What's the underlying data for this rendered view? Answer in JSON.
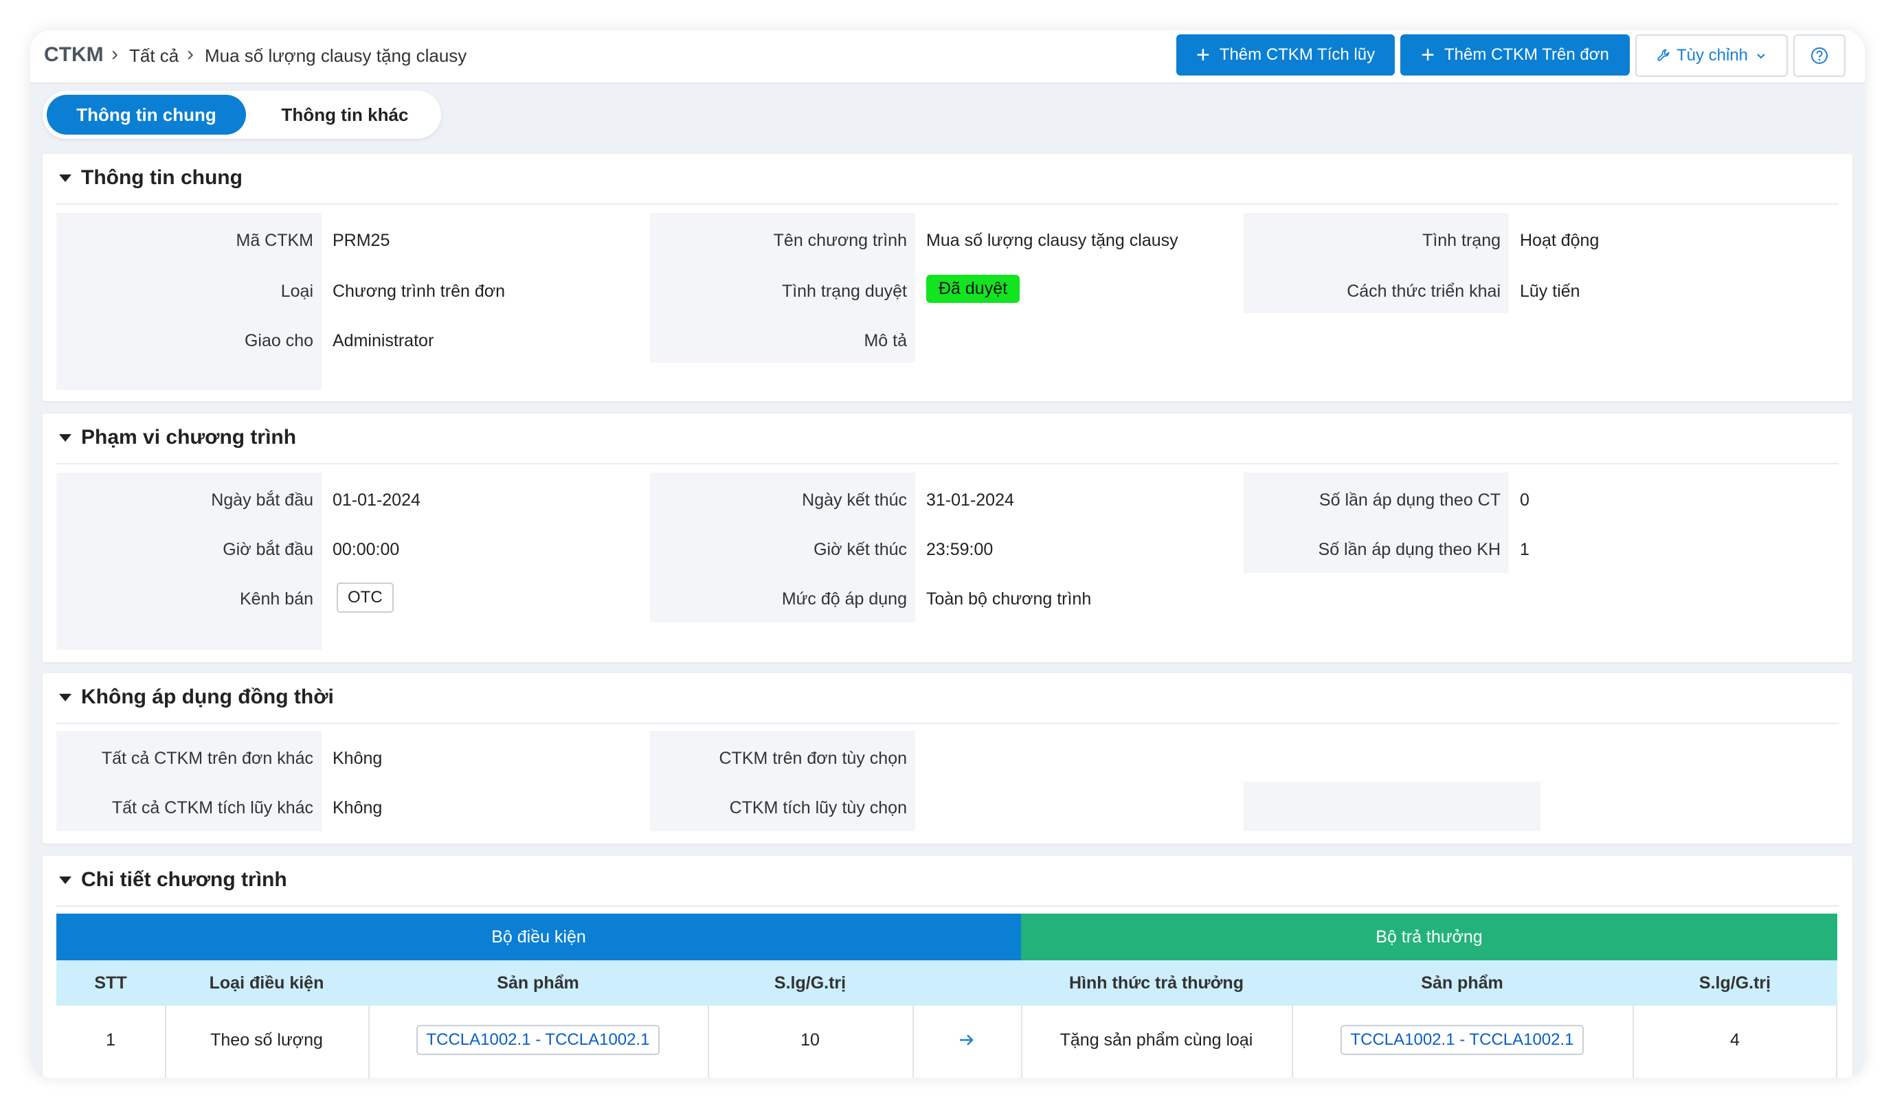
{
  "breadcrumb": {
    "root": "CTKM",
    "level1": "Tất cả",
    "current": "Mua số lượng clausy tặng clausy"
  },
  "toolbar": {
    "add_accumulate": "Thêm CTKM Tích lũy",
    "add_order": "Thêm CTKM Trên đơn",
    "customize": "Tùy chỉnh"
  },
  "tabs": [
    "Thông tin chung",
    "Thông tin khác"
  ],
  "general": {
    "title": "Thông tin chung",
    "ma_ctkm_label": "Mã CTKM",
    "ma_ctkm": "PRM25",
    "loai_label": "Loại",
    "loai": "Chương trình trên đơn",
    "giao_cho_label": "Giao cho",
    "giao_cho": "Administrator",
    "ten_label": "Tên chương trình",
    "ten": "Mua số lượng clausy tặng clausy",
    "tt_duyet_label": "Tình trạng duyệt",
    "tt_duyet": "Đã duyệt",
    "mo_ta_label": "Mô tả",
    "tinh_trang_label": "Tình trạng",
    "tinh_trang": "Hoạt động",
    "cach_thuc_label": "Cách thức triển khai",
    "cach_thuc": "Lũy tiến"
  },
  "scope": {
    "title": "Phạm vi chương trình",
    "ngay_bd_label": "Ngày bắt đầu",
    "ngay_bd": "01-01-2024",
    "gio_bd_label": "Giờ bắt đầu",
    "gio_bd": "00:00:00",
    "kenh_ban_label": "Kênh bán",
    "kenh_ban": "OTC",
    "ngay_kt_label": "Ngày kết thúc",
    "ngay_kt": "31-01-2024",
    "gio_kt_label": "Giờ kết thúc",
    "gio_kt": "23:59:00",
    "muc_do_label": "Mức độ áp dụng",
    "muc_do": "Toàn bộ chương trình",
    "so_lan_ct_label": "Số lần áp dụng theo CT",
    "so_lan_ct": "0",
    "so_lan_kh_label": "Số lần áp dụng theo KH",
    "so_lan_kh": "1"
  },
  "exclusive": {
    "title": "Không áp dụng đồng thời",
    "all_order_label": "Tất cả CTKM trên đơn khác",
    "all_order": "Không",
    "all_accum_label": "Tất cả CTKM tích lũy khác",
    "all_accum": "Không",
    "order_opt_label": "CTKM trên đơn tùy chọn",
    "accum_opt_label": "CTKM tích lũy tùy chọn"
  },
  "detail": {
    "title": "Chi tiết chương trình",
    "group_condition": "Bộ điều kiện",
    "group_reward": "Bộ trả thưởng",
    "columns": [
      "STT",
      "Loại điều kiện",
      "Sản phẩm",
      "S.lg/G.trị",
      "Hình thức trả thưởng",
      "Sản phẩm",
      "S.lg/G.trị"
    ],
    "rows": [
      {
        "stt": "1",
        "loai": "Theo số lượng",
        "sp": "TCCLA1002.1 - TCCLA1002.1",
        "slg": "10",
        "hinh_thuc": "Tặng sản phẩm cùng loại",
        "sp2": "TCCLA1002.1 - TCCLA1002.1",
        "slg2": "4"
      }
    ]
  },
  "colors": {
    "primary": "#0b7fd4",
    "reward": "#23b37a",
    "header_row": "#cdeefc",
    "approved": "#12e51f"
  }
}
